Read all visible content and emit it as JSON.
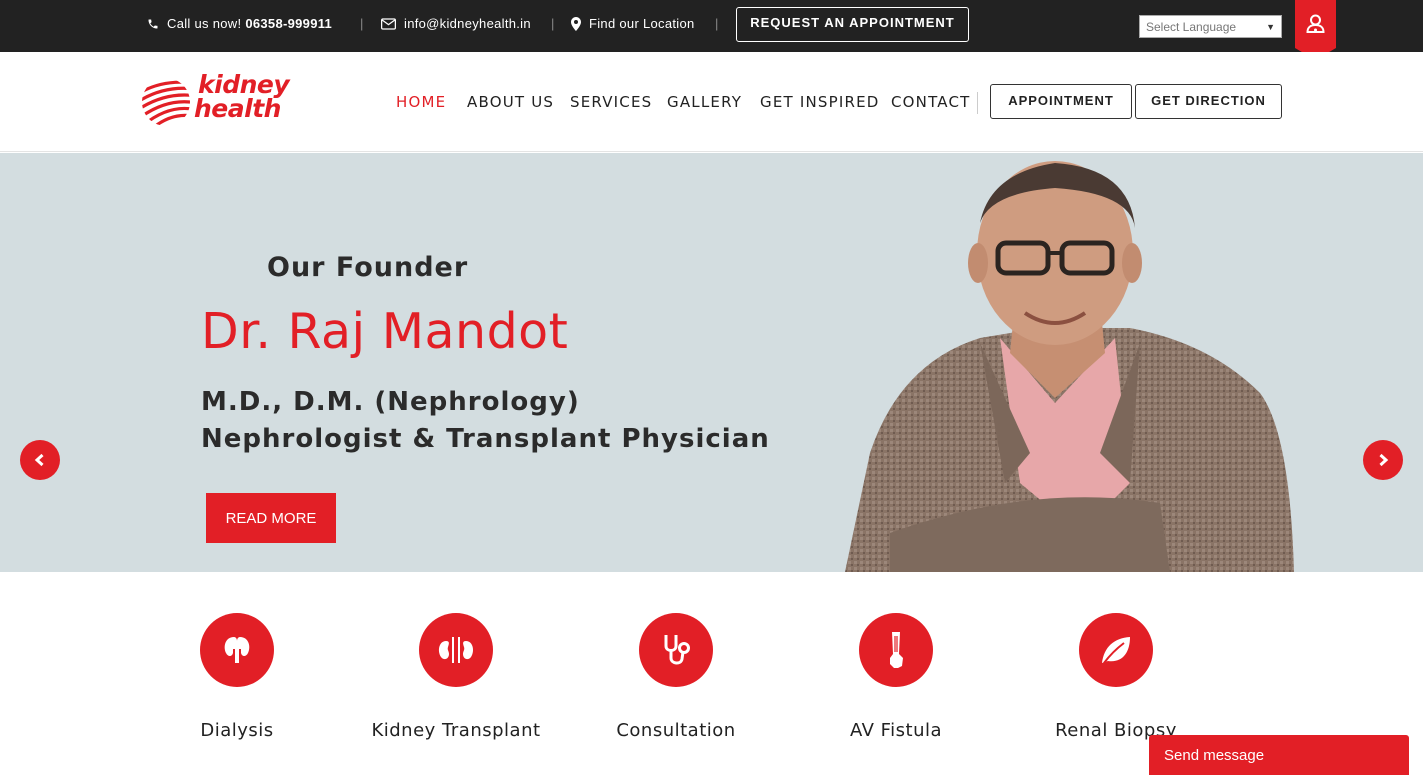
{
  "topbar": {
    "call_prefix": "Call us now!",
    "phone": "06358-999911",
    "email": "info@kidneyhealth.in",
    "location": "Find our Location",
    "separator": "|",
    "request_button": "REQUEST AN APPOINTMENT",
    "language_select": "Select Language",
    "icons": [
      "phone-icon",
      "envelope-icon",
      "map-marker-icon",
      "user-doctor-icon"
    ]
  },
  "logo": {
    "line1": "kidney",
    "line2": "health"
  },
  "nav": {
    "items": [
      "HOME",
      "ABOUT US",
      "SERVICES",
      "GALLERY",
      "GET INSPIRED",
      "CONTACT"
    ],
    "active": "HOME",
    "appointment_button": "APPOINTMENT",
    "direction_button": "GET DIRECTION"
  },
  "hero": {
    "eyebrow": "Our Founder",
    "name": "Dr. Raj Mandot",
    "degree": "M.D., D.M. (Nephrology)",
    "title": "Nephrologist & Transplant Physician",
    "read_more": "READ MORE"
  },
  "services": [
    {
      "label": "Dialysis",
      "icon": "kidney-icon"
    },
    {
      "label": "Kidney Transplant",
      "icon": "kidneys-icon"
    },
    {
      "label": "Consultation",
      "icon": "stethoscope-icon"
    },
    {
      "label": "AV Fistula",
      "icon": "arm-icon"
    },
    {
      "label": "Renal Biopsy",
      "icon": "leaf-icon"
    }
  ],
  "chat": {
    "label": "Send message"
  },
  "colors": {
    "brand_red": "#e21f26",
    "topbar_bg": "#222222",
    "hero_bg": "#d3dde0"
  }
}
